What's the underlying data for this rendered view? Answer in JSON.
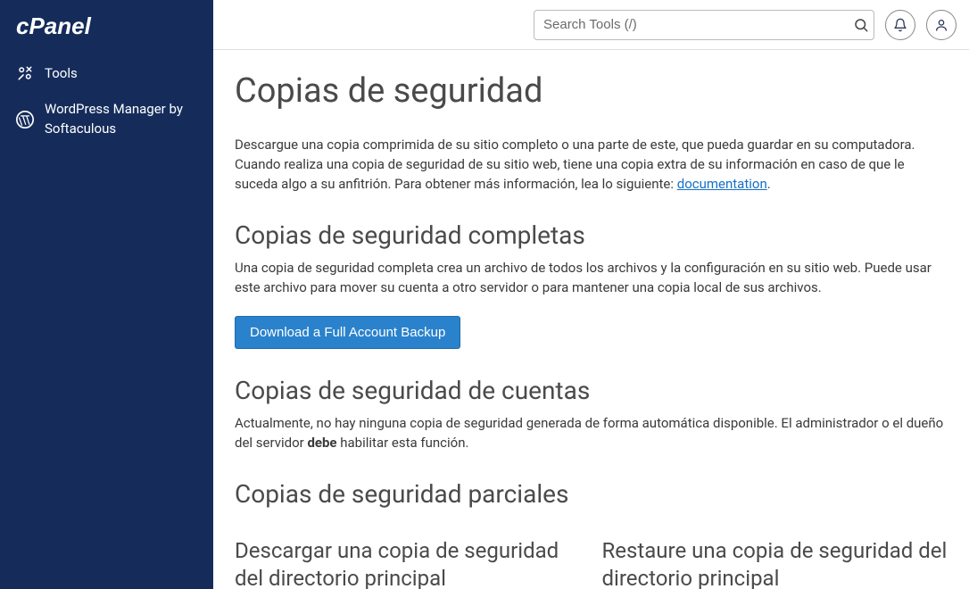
{
  "sidebar": {
    "items": [
      {
        "label": "Tools"
      },
      {
        "label": "WordPress Manager by Softaculous"
      }
    ]
  },
  "topbar": {
    "search_placeholder": "Search Tools (/)"
  },
  "page": {
    "title": "Copias de seguridad",
    "intro_prefix": "Descargue una copia comprimida de su sitio completo o una parte de este, que pueda guardar en su computadora. Cuando realiza una copia de seguridad de su sitio web, tiene una copia extra de su información en caso de que le suceda algo a su anfitrión. Para obtener más información, lea lo siguiente: ",
    "intro_link": "documentation",
    "intro_suffix": ".",
    "full": {
      "heading": "Copias de seguridad completas",
      "desc": "Una copia de seguridad completa crea un archivo de todos los archivos y la configuración en su sitio web. Puede usar este archivo para mover su cuenta a otro servidor o para mantener una copia local de sus archivos.",
      "button": "Download a Full Account Backup"
    },
    "accounts": {
      "heading": "Copias de seguridad de cuentas",
      "desc_prefix": "Actualmente, no hay ninguna copia de seguridad generada de forma automática disponible. El administrador o el dueño del servidor ",
      "desc_bold": "debe",
      "desc_suffix": " habilitar esta función."
    },
    "partial": {
      "heading": "Copias de seguridad parciales",
      "left_heading": "Descargar una copia de seguridad del directorio principal",
      "right_heading": "Restaure una copia de seguridad del directorio principal"
    }
  }
}
